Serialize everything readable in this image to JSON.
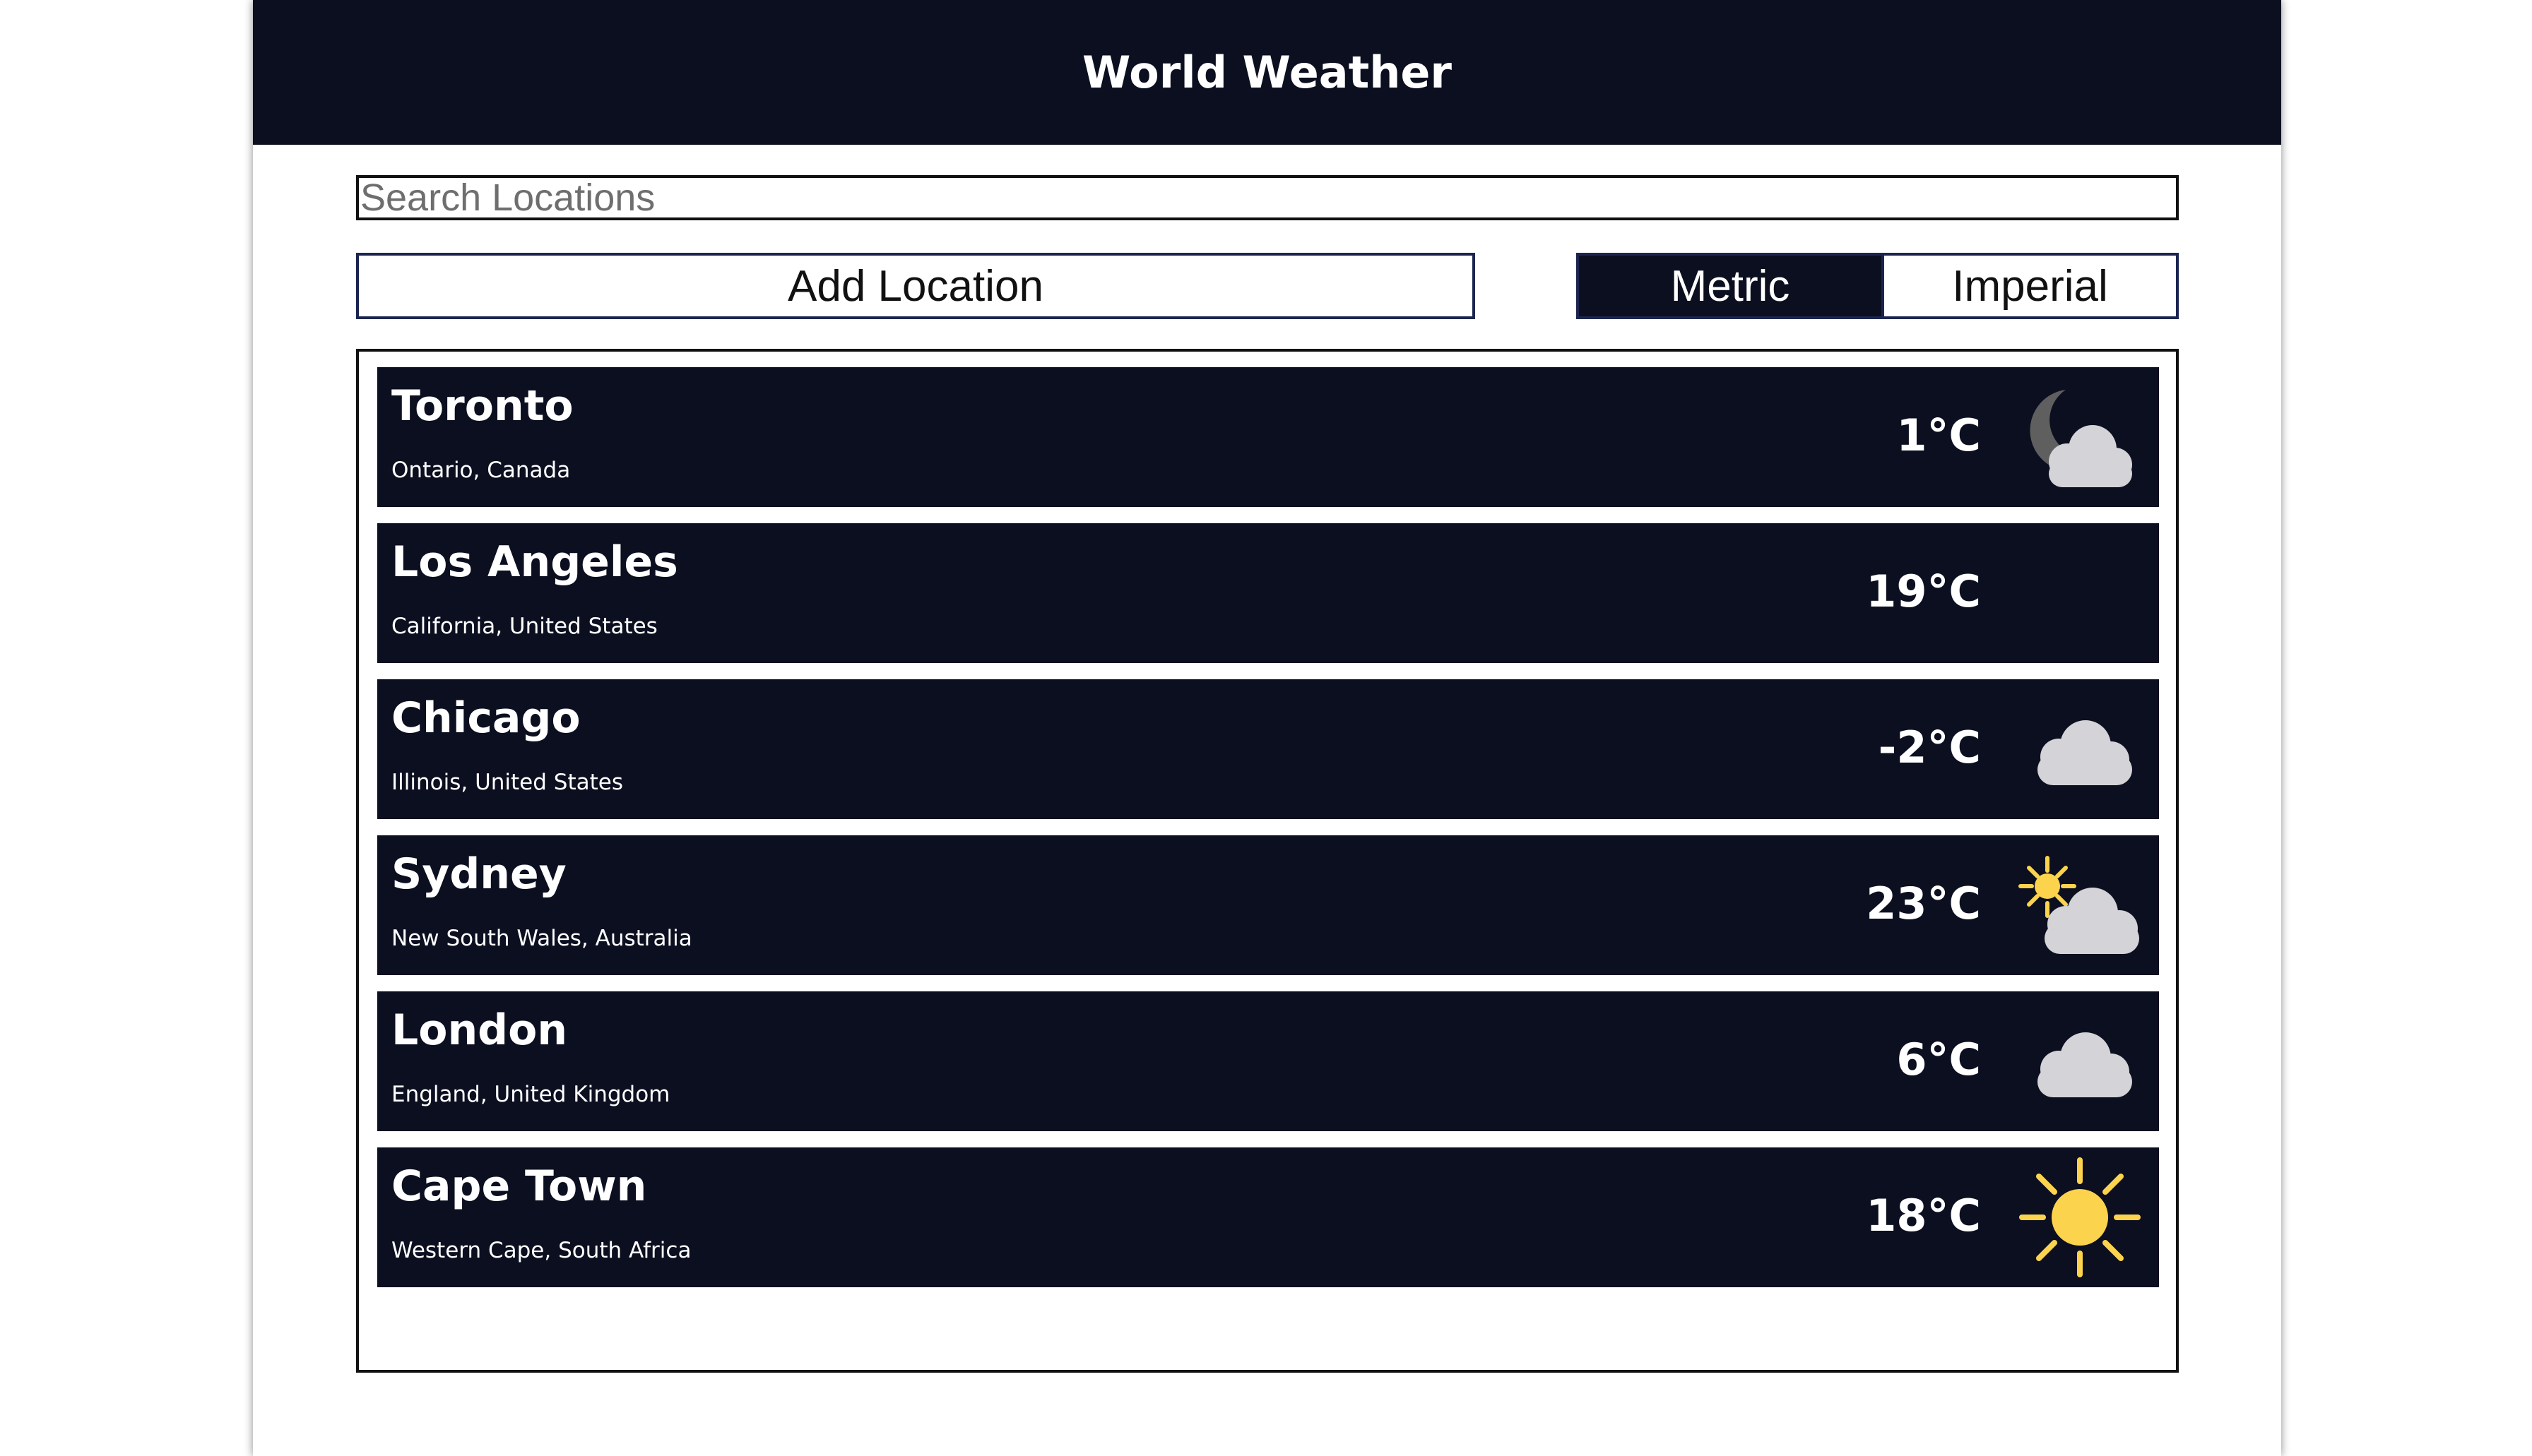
{
  "header": {
    "title": "World Weather"
  },
  "search": {
    "placeholder": "Search Locations",
    "value": ""
  },
  "actions": {
    "add_location_label": "Add Location"
  },
  "units": {
    "metric_label": "Metric",
    "imperial_label": "Imperial",
    "selected": "Metric"
  },
  "colors": {
    "header_bg": "#0b0f20",
    "card_bg": "#0b0f20",
    "sun": "#fcd34d",
    "cloud": "#d4d4d8",
    "moon": "#5f5f5f"
  },
  "locations": [
    {
      "city": "Toronto",
      "region": "Ontario, Canada",
      "temp": "1°C",
      "icon": "moon-cloud-icon"
    },
    {
      "city": "Los Angeles",
      "region": "California, United States",
      "temp": "19°C",
      "icon": "moon-icon"
    },
    {
      "city": "Chicago",
      "region": "Illinois, United States",
      "temp": "-2°C",
      "icon": "cloud-icon"
    },
    {
      "city": "Sydney",
      "region": "New South Wales, Australia",
      "temp": "23°C",
      "icon": "sun-cloud-icon"
    },
    {
      "city": "London",
      "region": "England, United Kingdom",
      "temp": "6°C",
      "icon": "cloud-icon"
    },
    {
      "city": "Cape Town",
      "region": "Western Cape, South Africa",
      "temp": "18°C",
      "icon": "sun-icon"
    }
  ]
}
